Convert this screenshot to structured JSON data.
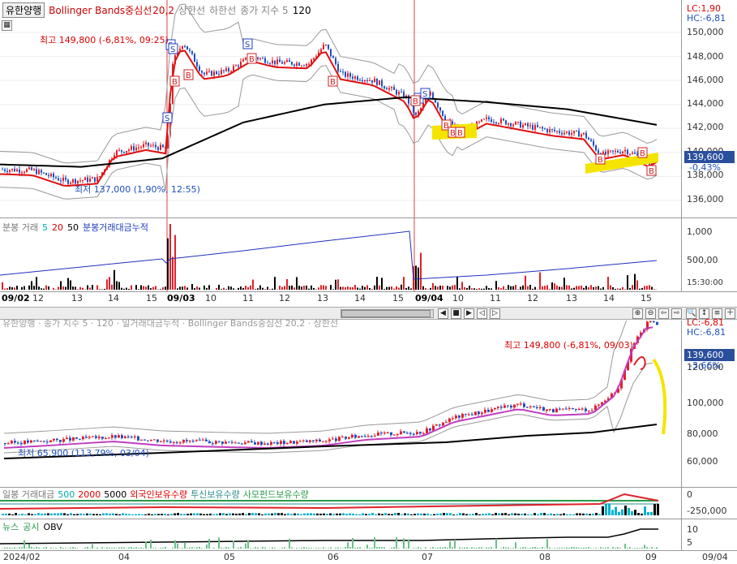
{
  "top_chart": {
    "legend": {
      "symbol": "유한양행",
      "indicator": "Bollinger Bands중심선",
      "params": "20,2",
      "upper": "상한선",
      "lower": "하한선",
      "ma_label": "종가 지수 5",
      "ma2": "120"
    },
    "lc": "LC:1,90",
    "hc": "HC:-6,81",
    "high_note": "최고 149,800 (-6,81%, 09:25)",
    "low_note": "최저 137,000 (1,90%, 12:55)",
    "price_label": "139,600",
    "change_label": "-0,43%",
    "y_ticks": [
      "150,000",
      "148,000",
      "146,000",
      "144,000",
      "142,000",
      "140,000",
      "138,000",
      "136,000"
    ],
    "signal_s": "S",
    "signal_b": "B"
  },
  "volume_pane": {
    "legend": {
      "title": "분봉 거래",
      "p1": "5",
      "p2": "20",
      "p3": "50",
      "cum": "분봉거래대금누적"
    },
    "y_ticks": [
      "1,000",
      "500,00"
    ],
    "time_label": "15:30:00"
  },
  "top_xaxis": {
    "labels": [
      "09/02",
      "12",
      "13",
      "14",
      "15",
      "09/03",
      "10",
      "11",
      "12",
      "13",
      "14",
      "15",
      "09/04",
      "10",
      "11",
      "12",
      "13",
      "14",
      "15"
    ]
  },
  "toolbar": {
    "buttons": [
      "◀",
      "■",
      "▶",
      "◁",
      "▷",
      "⊕",
      "⊖",
      "＋"
    ],
    "zoom_buttons": [
      "⇦",
      "⇨",
      "🔍",
      "↕",
      "≡"
    ]
  },
  "bottom_chart": {
    "legend": "유한양행 · 종가 지수 5 · 120 · 일거래대금누적 · Bollinger Bands중심선 20,2 · 상한선",
    "lc": "LC:-6,81",
    "hc": "HC:-6,81",
    "high_note": "최고 149,800 (-6,81%, 09/03)",
    "low_note": "최저 65,900 (113,79%, 03/04)",
    "price_label": "139,600",
    "change_label": "-3,66%",
    "y_ticks": [
      "120,000",
      "100,000",
      "80,000",
      "60,000"
    ]
  },
  "investor_pane": {
    "legend": {
      "title": "일봉 거래대금",
      "p1": "500",
      "p2": "2000",
      "p3": "5000",
      "foreign": "외국인보유수량",
      "trust": "투신보유수량",
      "private": "사모펀드보유수량"
    },
    "y_ticks": [
      "0",
      "-250,000"
    ]
  },
  "obv_pane": {
    "legend": {
      "news": "뉴스",
      "disclosure": "공시",
      "obv": "OBV"
    },
    "y_ticks": [
      "10",
      "5"
    ]
  },
  "bottom_xaxis": {
    "labels": [
      "2024/02",
      "04",
      "05",
      "06",
      "07",
      "08",
      "09",
      "09/04"
    ]
  },
  "colors": {
    "up": "#e0202a",
    "down": "#1f4fbf",
    "bollinger": "#e01010",
    "ma120": "#000000",
    "band": "#999999",
    "highlight": "#f5e400",
    "purple": "#c03cc0"
  }
}
